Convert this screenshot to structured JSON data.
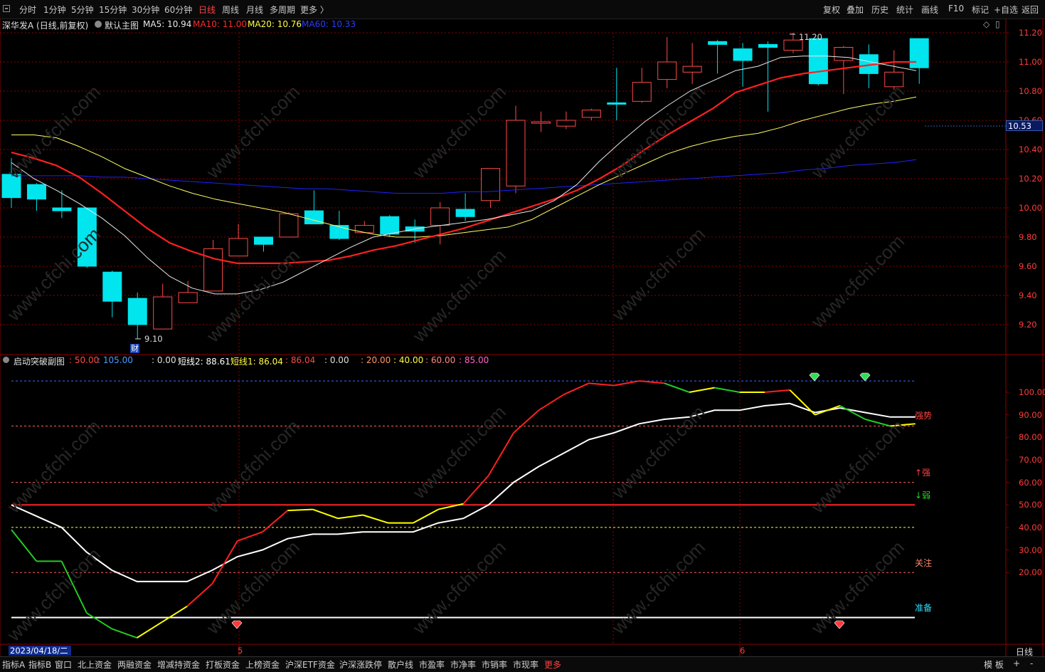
{
  "toolbar": {
    "periods": [
      "分时",
      "1分钟",
      "5分钟",
      "15分钟",
      "30分钟",
      "60分钟",
      "日线",
      "周线",
      "月线",
      "多周期",
      "更多 〉"
    ],
    "active_period": "日线",
    "right_items": [
      "复权",
      "叠加",
      "历史",
      "统计",
      "画线",
      "F10",
      "标记",
      "+自选",
      "返回"
    ]
  },
  "main_info": {
    "stock": "深华发A (日线,前复权)",
    "template": "默认主图",
    "ma5": "MA5: 10.94",
    "ma10": "MA10: 11.00",
    "ma20": "MA20: 10.76",
    "ma60": "MA60: 10.33"
  },
  "sub_info": {
    "name": "启动突破副图",
    "v1": ": 50.00",
    "v2": ": 105.00",
    "v3": ": 0.00",
    "v4": "短线2: 88.61",
    "v5": "短线1: 86.04",
    "v6": ": 86.04",
    "v7": ": 0.00",
    "v8": ": 20.00",
    "v9": ": 40.00",
    "v10": ": 60.00",
    "v11": ": 85.00"
  },
  "price_axis": [
    "11.20",
    "11.00",
    "10.80",
    "10.60",
    "10.40",
    "10.20",
    "10.00",
    "9.80",
    "9.60",
    "9.40",
    "9.20"
  ],
  "current_price": "10.53",
  "high_label": "11.20",
  "low_label": "9.10",
  "cai_label": "财",
  "sub_axis": [
    "100.00",
    "90.00",
    "80.00",
    "70.00",
    "60.00",
    "50.00",
    "40.00",
    "30.00",
    "20.00"
  ],
  "sub_labels": {
    "strong": "强势",
    "up_strong": "↑强",
    "down_weak": "↓弱",
    "watch": "关注",
    "ready": "准备"
  },
  "date_axis": {
    "current": "2023/04/18/二",
    "m5": "5",
    "m6": "6",
    "period": "日线"
  },
  "bottom_tabs": [
    "指标A",
    "指标B",
    "窗口",
    "北上资金",
    "两融资金",
    "增减持资金",
    "打板资金",
    "上榜资金",
    "沪深ETF资金",
    "沪深涨跌停",
    "散户线",
    "市盈率",
    "市净率",
    "市销率",
    "市现率",
    "更多"
  ],
  "bottom_right": [
    "模 板",
    "+",
    "-"
  ],
  "watermark": "www.cfchi.com",
  "colors": {
    "up": "#ff4a4a",
    "down": "#00e5ee",
    "ma5": "#e8e8e8",
    "ma10": "#ff2020",
    "ma20": "#ffff66",
    "ma60": "#2020ff",
    "grid": "#8b0000"
  },
  "chart_data": [
    {
      "type": "candlestick",
      "title": "深华发A (日线,前复权)",
      "ylim": [
        9.05,
        11.25
      ],
      "candles": [
        {
          "o": 10.23,
          "h": 10.34,
          "l": 10.0,
          "c": 10.07
        },
        {
          "o": 10.16,
          "h": 10.17,
          "l": 9.98,
          "c": 10.06
        },
        {
          "o": 10.0,
          "h": 10.12,
          "l": 9.93,
          "c": 9.98
        },
        {
          "o": 10.0,
          "h": 10.0,
          "l": 9.59,
          "c": 9.6
        },
        {
          "o": 9.56,
          "h": 9.57,
          "l": 9.25,
          "c": 9.36
        },
        {
          "o": 9.38,
          "h": 9.42,
          "l": 9.1,
          "c": 9.2
        },
        {
          "o": 9.17,
          "h": 9.48,
          "l": 9.17,
          "c": 9.39
        },
        {
          "o": 9.35,
          "h": 9.5,
          "l": 9.35,
          "c": 9.42
        },
        {
          "o": 9.43,
          "h": 9.78,
          "l": 9.43,
          "c": 9.72
        },
        {
          "o": 9.67,
          "h": 9.89,
          "l": 9.67,
          "c": 9.79
        },
        {
          "o": 9.8,
          "h": 9.8,
          "l": 9.7,
          "c": 9.75
        },
        {
          "o": 9.8,
          "h": 9.97,
          "l": 9.8,
          "c": 9.96
        },
        {
          "o": 9.98,
          "h": 10.12,
          "l": 9.9,
          "c": 9.89
        },
        {
          "o": 9.88,
          "h": 9.98,
          "l": 9.78,
          "c": 9.79
        },
        {
          "o": 9.83,
          "h": 9.91,
          "l": 9.83,
          "c": 9.88
        },
        {
          "o": 9.94,
          "h": 9.95,
          "l": 9.8,
          "c": 9.82
        },
        {
          "o": 9.87,
          "h": 9.92,
          "l": 9.76,
          "c": 9.84
        },
        {
          "o": 9.88,
          "h": 10.04,
          "l": 9.75,
          "c": 10.0
        },
        {
          "o": 9.99,
          "h": 10.1,
          "l": 9.91,
          "c": 9.94
        },
        {
          "o": 10.05,
          "h": 10.27,
          "l": 10.0,
          "c": 10.27
        },
        {
          "o": 10.15,
          "h": 10.7,
          "l": 10.1,
          "c": 10.6
        },
        {
          "o": 10.58,
          "h": 10.66,
          "l": 10.52,
          "c": 10.59
        },
        {
          "o": 10.56,
          "h": 10.66,
          "l": 10.54,
          "c": 10.6
        },
        {
          "o": 10.62,
          "h": 10.68,
          "l": 10.6,
          "c": 10.67
        },
        {
          "o": 10.72,
          "h": 10.96,
          "l": 10.6,
          "c": 10.71
        },
        {
          "o": 10.73,
          "h": 10.96,
          "l": 10.72,
          "c": 10.86
        },
        {
          "o": 10.88,
          "h": 11.17,
          "l": 10.82,
          "c": 11.0
        },
        {
          "o": 10.93,
          "h": 11.13,
          "l": 10.85,
          "c": 10.97
        },
        {
          "o": 11.14,
          "h": 11.15,
          "l": 10.92,
          "c": 11.12
        },
        {
          "o": 11.09,
          "h": 11.13,
          "l": 10.83,
          "c": 11.01
        },
        {
          "o": 11.12,
          "h": 11.14,
          "l": 10.66,
          "c": 11.1
        },
        {
          "o": 11.08,
          "h": 11.2,
          "l": 11.06,
          "c": 11.15
        },
        {
          "o": 11.16,
          "h": 11.16,
          "l": 10.84,
          "c": 10.85
        },
        {
          "o": 11.01,
          "h": 11.11,
          "l": 10.78,
          "c": 11.1
        },
        {
          "o": 11.05,
          "h": 11.12,
          "l": 10.82,
          "c": 10.92
        },
        {
          "o": 10.83,
          "h": 11.08,
          "l": 10.81,
          "c": 10.93
        },
        {
          "o": 11.16,
          "h": 11.16,
          "l": 10.85,
          "c": 10.96
        }
      ],
      "ma5": [
        10.31,
        10.2,
        10.12,
        10.03,
        9.93,
        9.81,
        9.66,
        9.53,
        9.45,
        9.41,
        9.41,
        9.44,
        9.49,
        9.57,
        9.65,
        9.73,
        9.8,
        9.83,
        9.86,
        9.88,
        9.9,
        9.92,
        9.95,
        9.98,
        10.05,
        10.16,
        10.32,
        10.46,
        10.59,
        10.7,
        10.8,
        10.87,
        10.94,
        10.97,
        11.03,
        11.04,
        11.04,
        11.03,
        11.0,
        10.97,
        10.94
      ],
      "ma10": [
        10.38,
        10.34,
        10.29,
        10.21,
        10.1,
        9.98,
        9.86,
        9.76,
        9.7,
        9.65,
        9.62,
        9.62,
        9.62,
        9.63,
        9.64,
        9.67,
        9.71,
        9.74,
        9.78,
        9.82,
        9.86,
        9.91,
        9.96,
        10.01,
        10.06,
        10.12,
        10.2,
        10.29,
        10.4,
        10.5,
        10.59,
        10.68,
        10.79,
        10.84,
        10.89,
        10.92,
        10.94,
        10.96,
        10.98,
        11.0,
        11.0
      ],
      "ma20": [
        10.5,
        10.5,
        10.48,
        10.42,
        10.35,
        10.27,
        10.21,
        10.15,
        10.1,
        10.06,
        10.03,
        10.0,
        9.97,
        9.93,
        9.89,
        9.85,
        9.82,
        9.8,
        9.8,
        9.81,
        9.83,
        9.85,
        9.87,
        9.92,
        10.0,
        10.08,
        10.16,
        10.23,
        10.3,
        10.37,
        10.42,
        10.46,
        10.49,
        10.51,
        10.55,
        10.6,
        10.64,
        10.68,
        10.71,
        10.73,
        10.76
      ],
      "ma60": [
        10.22,
        10.22,
        10.22,
        10.22,
        10.21,
        10.21,
        10.2,
        10.19,
        10.18,
        10.17,
        10.16,
        10.15,
        10.14,
        10.13,
        10.13,
        10.12,
        10.11,
        10.1,
        10.1,
        10.1,
        10.11,
        10.11,
        10.12,
        10.13,
        10.14,
        10.15,
        10.16,
        10.17,
        10.18,
        10.19,
        10.2,
        10.21,
        10.22,
        10.23,
        10.24,
        10.26,
        10.27,
        10.29,
        10.3,
        10.31,
        10.33
      ]
    },
    {
      "type": "line",
      "title": "启动突破副图",
      "ylim": [
        -10,
        115
      ],
      "hlines": [
        105,
        85,
        60,
        50,
        40,
        20,
        0
      ],
      "series": [
        {
          "name": "短线2",
          "values": [
            50,
            45,
            40,
            29,
            21,
            16,
            16,
            16,
            21,
            27,
            30,
            35,
            37,
            37,
            38,
            38,
            38,
            42,
            44,
            50,
            60,
            67,
            73,
            79,
            82,
            86,
            88,
            89,
            92,
            92,
            94,
            95,
            91,
            93,
            91,
            89,
            89
          ]
        },
        {
          "name": "短线1",
          "values": [
            39,
            25,
            25,
            2,
            -5,
            -9,
            -2,
            5,
            15,
            34,
            38,
            47.5,
            48,
            44,
            45.5,
            42,
            42,
            48,
            50.5,
            63,
            82,
            92,
            99,
            104,
            103,
            105,
            104,
            100,
            102,
            100,
            100,
            101,
            90,
            94,
            88,
            85,
            86
          ]
        }
      ]
    }
  ]
}
